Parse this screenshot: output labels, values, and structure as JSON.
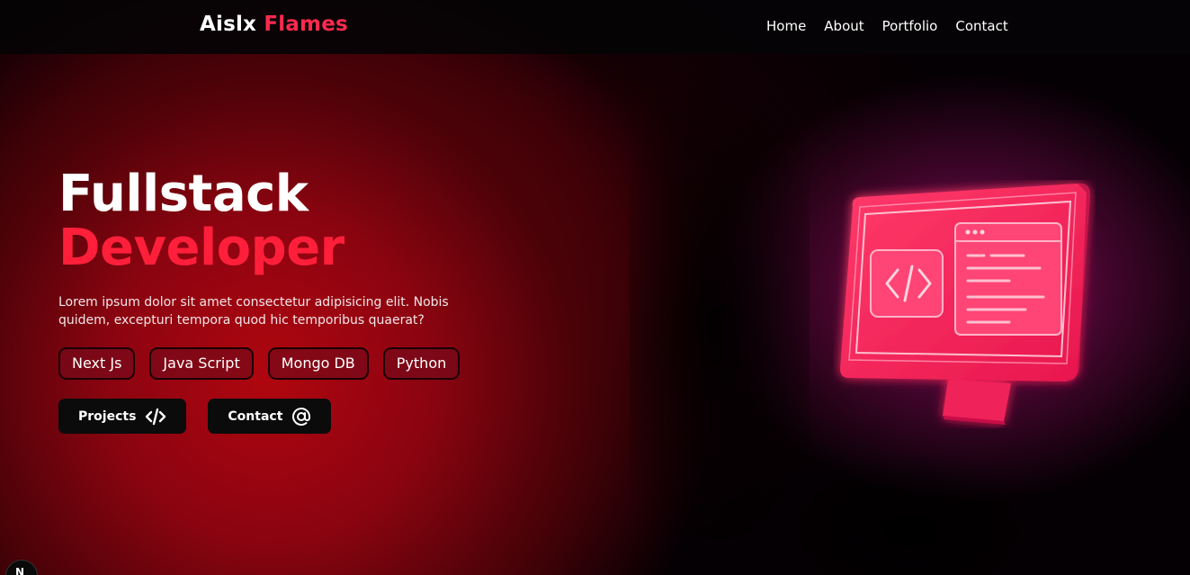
{
  "brand": {
    "name": "Aislx",
    "accent": "Flames"
  },
  "nav": {
    "items": [
      "Home",
      "About",
      "Portfolio",
      "Contact"
    ]
  },
  "hero": {
    "title_line1": "Fullstack",
    "title_line2": "Developer",
    "description": "Lorem ipsum dolor sit amet consectetur adipisicing elit. Nobis quidem, excepturi tempora quod hic temporibus quaerat?",
    "tags": [
      "Next Js",
      "Java Script",
      "Mongo DB",
      "Python"
    ],
    "buttons": {
      "projects": {
        "label": "Projects",
        "icon": "code-icon"
      },
      "contact": {
        "label": "Contact",
        "icon": "at-sign-icon"
      }
    }
  },
  "illustration": {
    "icon": "monitor-code-icon"
  },
  "corner_badge": {
    "letter": "N",
    "icon": "nextjs-badge-icon"
  },
  "colors": {
    "accent": "#ff1f3a",
    "brand_accent": "#ff2a4d",
    "tag_bg": "#780a19",
    "button_bg": "#0b0b0b",
    "monitor_pink": "#ff2d5e"
  }
}
